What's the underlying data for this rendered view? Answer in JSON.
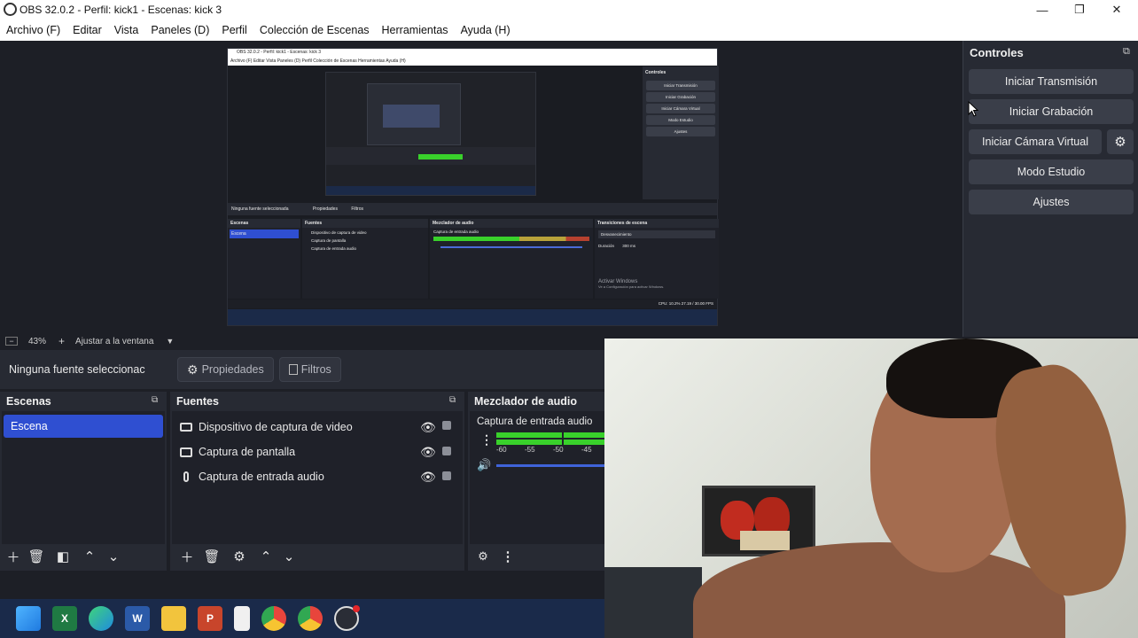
{
  "window": {
    "title": "OBS 32.0.2 - Perfil: kick1 - Escenas: kick 3",
    "minimize": "—",
    "maximize": "❐",
    "close": "✕"
  },
  "menu": [
    "Archivo (F)",
    "Editar",
    "Vista",
    "Paneles (D)",
    "Perfil",
    "Colección de Escenas",
    "Herramientas",
    "Ayuda (H)"
  ],
  "controls": {
    "title": "Controles",
    "buttons": [
      "Iniciar Transmisión",
      "Iniciar Grabación",
      "Iniciar Cámara Virtual",
      "Modo Estudio",
      "Ajustes"
    ]
  },
  "zoom": {
    "value": "43%",
    "fit_label": "Ajustar a la ventana"
  },
  "source_toolbar": {
    "no_source": "Ninguna fuente seleccionac",
    "properties": "Propiedades",
    "filters": "Filtros"
  },
  "scenes": {
    "title": "Escenas",
    "items": [
      "Escena"
    ]
  },
  "sources": {
    "title": "Fuentes",
    "items": [
      {
        "label": "Dispositivo de captura de video",
        "icon": "camera-icon"
      },
      {
        "label": "Captura de pantalla",
        "icon": "monitor-icon"
      },
      {
        "label": "Captura de entrada audio",
        "icon": "microphone-icon"
      }
    ]
  },
  "mixer": {
    "title": "Mezclador de audio",
    "channel": "Captura de entrada audio",
    "ticks": [
      "-60",
      "-55",
      "-50",
      "-45"
    ]
  },
  "nested_preview": {
    "title": "OBS 32.0.2 - Perfil: kick1 - Escenas: kick 3",
    "menu": "Archivo (F)  Editar  Vista  Paneles (D)  Perfil  Colección de Escenas  Herramientas  Ayuda (H)",
    "controls_title": "Controles",
    "controls_buttons": [
      "Iniciar Transmisión",
      "Iniciar Grabación",
      "Iniciar Cámara Virtual",
      "Modo Estudio",
      "Ajustes"
    ],
    "no_source": "Ninguna fuente seleccionada",
    "properties": "Propiedades",
    "filters": "Filtros",
    "scenes_title": "Escenas",
    "scene_item": "Escena",
    "sources_title": "Fuentes",
    "sources": [
      "Dispositivo de captura de video",
      "Captura de pantalla",
      "Captura de entrada audio"
    ],
    "mixer_title": "Mezclador de audio",
    "mixer_channel": "Captura de entrada audio",
    "transitions_title": "Transiciones de escena",
    "transition_value": "Desvanecimiento",
    "duration_label": "Duración",
    "duration_value": "300 ms",
    "activate_line1": "Activar Windows",
    "activate_line2": "Ve a Configuración para activar Windows.",
    "status": "CPU: 10.2%   27.19 / 30.00 FPS"
  },
  "colors": {
    "accent": "#2f4fd1",
    "meter_green": "#39d12b",
    "panel": "#272a33",
    "background": "#1d1f26"
  }
}
